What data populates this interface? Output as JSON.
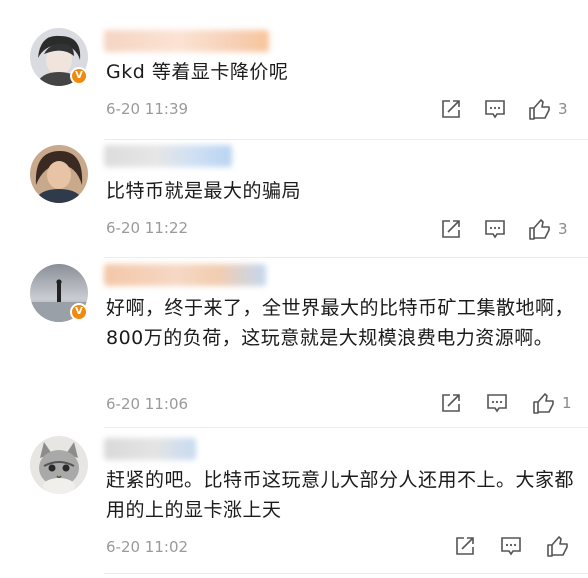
{
  "comments": [
    {
      "text": "Gkd 等着显卡降价呢",
      "time": "6-20 11:39",
      "likes": "3",
      "verified_badge": "V",
      "avatar_icon": "avatar-icon",
      "colors": {
        "badge": "#f08a0f"
      }
    },
    {
      "text": "比特币就是最大的骗局",
      "time": "6-20 11:22",
      "likes": "3",
      "avatar_icon": "avatar-icon"
    },
    {
      "text": "好啊，终于来了，全世界最大的比特币矿工集散地啊，800万的负荷，这玩意就是大规模浪费电力资源啊。",
      "time": "6-20 11:06",
      "likes": "1",
      "verified_badge": "V",
      "avatar_icon": "avatar-icon"
    },
    {
      "text": "赶紧的吧。比特币这玩意儿大部分人还用不上。大家都用的上的显卡涨上天",
      "time": "6-20 11:02",
      "likes": "",
      "avatar_icon": "avatar-icon"
    }
  ],
  "icons": {
    "share": "share-icon",
    "reply": "comment-icon",
    "like": "thumbs-up-icon"
  }
}
